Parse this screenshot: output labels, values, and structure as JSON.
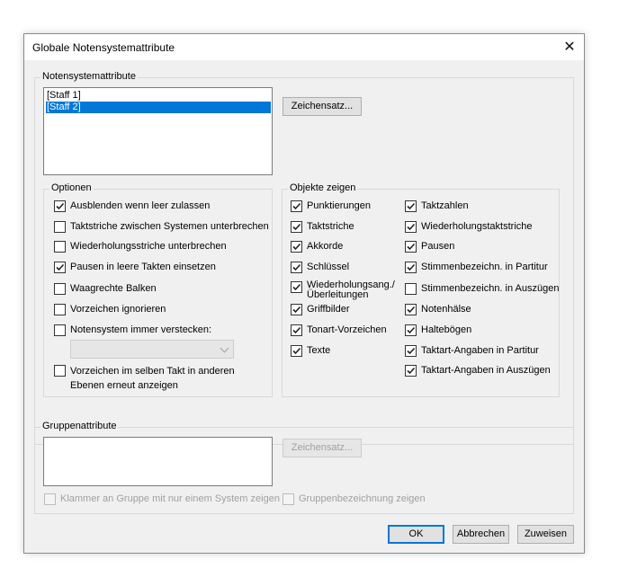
{
  "window": {
    "title": "Globale Notensystemattribute",
    "close_glyph": "✕"
  },
  "staff_attrs": {
    "legend": "Notensystemattribute",
    "staves": [
      "[Staff 1]",
      "[Staff 2]"
    ],
    "selected_index": 1,
    "font_button": "Zeichensatz..."
  },
  "options": {
    "legend": "Optionen",
    "items": [
      {
        "label": "Ausblenden wenn leer zulassen",
        "checked": true
      },
      {
        "label": "Taktstriche zwischen Systemen unterbrechen",
        "checked": false
      },
      {
        "label": "Wiederholungsstriche unterbrechen",
        "checked": false
      },
      {
        "label": "Pausen in leere Takten einsetzen",
        "checked": true
      },
      {
        "label": "Waagrechte Balken",
        "checked": false
      },
      {
        "label": "Vorzeichen ignorieren",
        "checked": false
      },
      {
        "label": "Notensystem immer verstecken:",
        "checked": false
      },
      {
        "label": "Vorzeichen im selben Takt in anderen Ebenen erneut anzeigen",
        "line1": "Vorzeichen im selben Takt in anderen",
        "line2": "Ebenen erneut anzeigen",
        "checked": false
      }
    ],
    "hide_combo_value": ""
  },
  "show_objects": {
    "legend": "Objekte zeigen",
    "left": [
      {
        "label": "Punktierungen",
        "checked": true
      },
      {
        "label": "Taktstriche",
        "checked": true
      },
      {
        "label": "Akkorde",
        "checked": true
      },
      {
        "label": "Schlüssel",
        "checked": true
      },
      {
        "label": "Wiederholungsang./ Überleitungen",
        "line1": "Wiederholungsang./",
        "line2": "Überleitungen",
        "checked": true
      },
      {
        "label": "Griffbilder",
        "checked": true
      },
      {
        "label": "Tonart-Vorzeichen",
        "checked": true
      },
      {
        "label": "Texte",
        "checked": true
      }
    ],
    "right": [
      {
        "label": "Taktzahlen",
        "checked": true
      },
      {
        "label": "Wiederholungstaktstriche",
        "checked": true
      },
      {
        "label": "Pausen",
        "checked": true
      },
      {
        "label": "Stimmenbezeichn. in Partitur",
        "checked": true
      },
      {
        "label": "Stimmenbezeichn. in Auszügen",
        "checked": false
      },
      {
        "label": "Notenhälse",
        "checked": true
      },
      {
        "label": "Haltebögen",
        "checked": true
      },
      {
        "label": "Taktart-Angaben in Partitur",
        "checked": true
      },
      {
        "label": "Taktart-Angaben in Auszügen",
        "checked": true
      }
    ]
  },
  "group_attrs": {
    "legend": "Gruppenattribute",
    "font_button": "Zeichensatz...",
    "bracket_checkbox": "Klammer an Gruppe mit nur einem System zeigen",
    "name_checkbox": "Gruppenbezeichnung zeigen"
  },
  "buttons": {
    "ok": "OK",
    "cancel": "Abbrechen",
    "apply": "Zuweisen"
  }
}
